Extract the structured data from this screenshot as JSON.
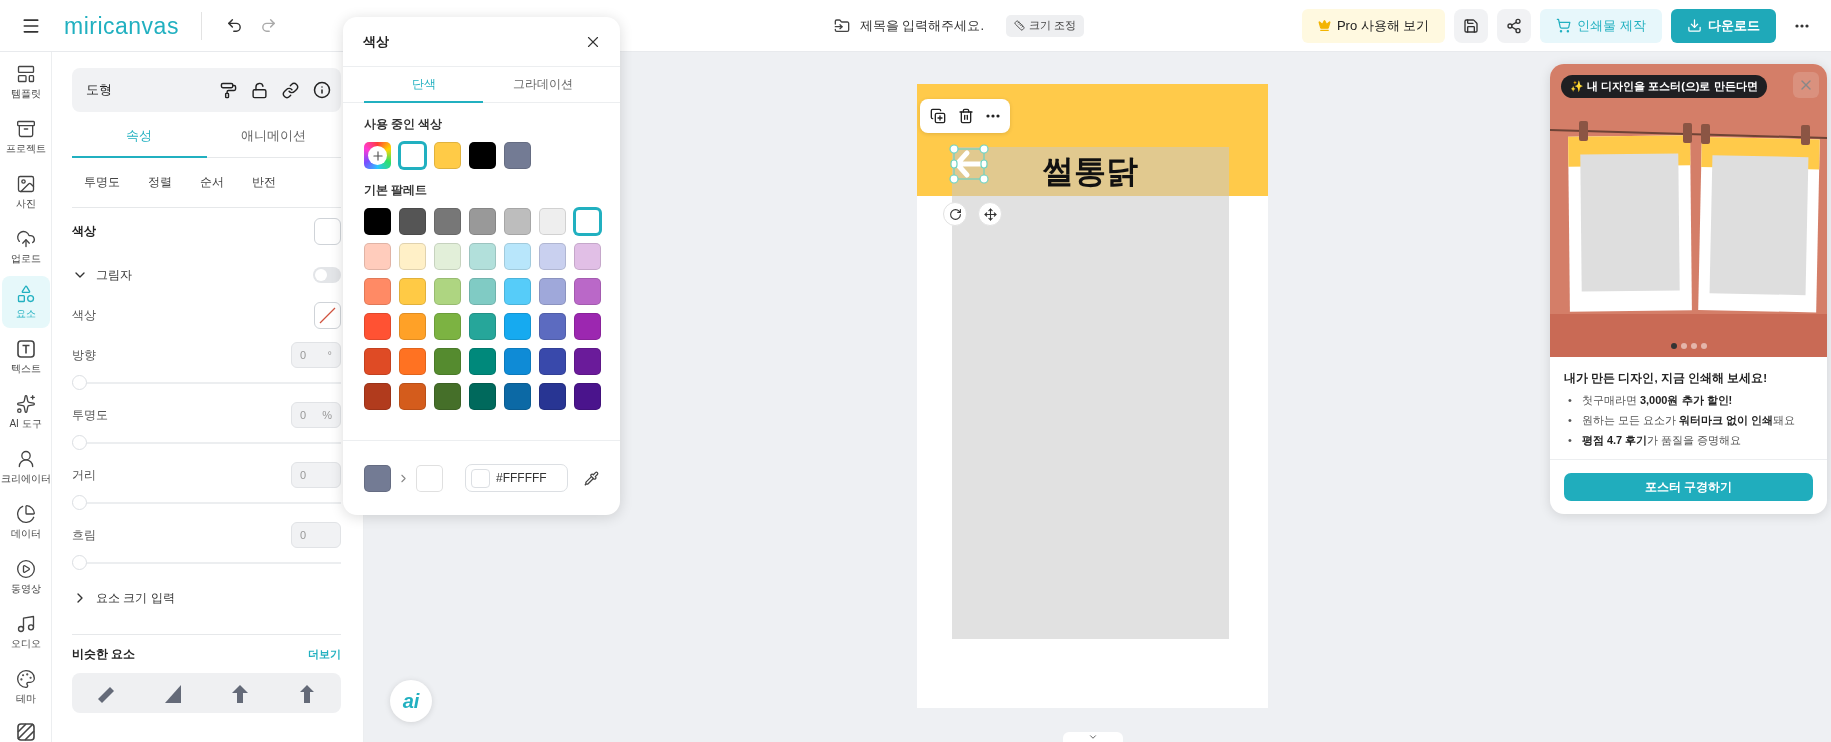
{
  "topbar": {
    "logo": "miricanvas",
    "title_field": {
      "placeholder": "제목을 입력해주세요."
    },
    "resize": "크기 조정",
    "pro_button": "Pro 사용해 보기",
    "print_button": "인쇄물 제작",
    "download_button": "다운로드"
  },
  "rail": [
    {
      "label": "템플릿",
      "selected": false
    },
    {
      "label": "프로젝트",
      "selected": false
    },
    {
      "label": "사진",
      "selected": false
    },
    {
      "label": "업로드",
      "selected": false
    },
    {
      "label": "요소",
      "selected": true
    },
    {
      "label": "텍스트",
      "selected": false
    },
    {
      "label": "AI 도구",
      "selected": false
    },
    {
      "label": "크리에이터",
      "selected": false
    },
    {
      "label": "데이터",
      "selected": false
    },
    {
      "label": "동영상",
      "selected": false
    },
    {
      "label": "오디오",
      "selected": false
    },
    {
      "label": "테마",
      "selected": false
    }
  ],
  "panel": {
    "title": "도형",
    "tabs": [
      {
        "label": "속성",
        "selected": true
      },
      {
        "label": "애니메이션",
        "selected": false
      }
    ],
    "subtabs": [
      "투명도",
      "정렬",
      "순서",
      "반전"
    ],
    "color_label": "색상",
    "color": "#ffffff",
    "shadow": {
      "label": "그림자",
      "expanded": true,
      "on": false,
      "color_label": "색상",
      "sliders": [
        {
          "label": "방향",
          "value": "0",
          "unit": "°",
          "level": 0
        },
        {
          "label": "투명도",
          "value": "0",
          "unit": "%",
          "level": 0
        },
        {
          "label": "거리",
          "value": "0",
          "level": 0
        },
        {
          "label": "흐림",
          "value": "0",
          "level": 0
        }
      ]
    },
    "size_section": {
      "label": "요소 크기 입력",
      "expanded": false
    },
    "similar": {
      "title": "비슷한 요소",
      "more": "더보기"
    }
  },
  "color_popup": {
    "title": "색상",
    "tabs": [
      {
        "label": "단색",
        "selected": true
      },
      {
        "label": "그라데이션",
        "selected": false
      }
    ],
    "used_label": "사용 중인 색상",
    "used": [
      {
        "kind": "add",
        "selected": false
      },
      {
        "kind": "color",
        "color": "#ffffff",
        "selected": true
      },
      {
        "kind": "color",
        "color": "#ffcb47",
        "selected": false
      },
      {
        "kind": "color",
        "color": "#000000",
        "selected": false
      },
      {
        "kind": "color",
        "color": "#737b94",
        "selected": false
      }
    ],
    "palette_label": "기본 팔레트",
    "palette": [
      {
        "color": "#000000",
        "selected": false
      },
      {
        "color": "#555555",
        "selected": false
      },
      {
        "color": "#777777",
        "selected": false
      },
      {
        "color": "#999999",
        "selected": false
      },
      {
        "color": "#bdbdbd",
        "selected": false
      },
      {
        "color": "#eeeeee",
        "selected": false
      },
      {
        "color": "#ffffff",
        "selected": true
      },
      {
        "color": "#ffccbc",
        "selected": false
      },
      {
        "color": "#fff0c7",
        "selected": false
      },
      {
        "color": "#e2efd9",
        "selected": false
      },
      {
        "color": "#b2e0db",
        "selected": false
      },
      {
        "color": "#b8e6fb",
        "selected": false
      },
      {
        "color": "#c9d0ef",
        "selected": false
      },
      {
        "color": "#e1bfe6",
        "selected": false
      },
      {
        "color": "#ff8a65",
        "selected": false
      },
      {
        "color": "#ffca45",
        "selected": false
      },
      {
        "color": "#aed581",
        "selected": false
      },
      {
        "color": "#80cbc4",
        "selected": false
      },
      {
        "color": "#56ccf9",
        "selected": false
      },
      {
        "color": "#9fa8da",
        "selected": false
      },
      {
        "color": "#ba68c8",
        "selected": false
      },
      {
        "color": "#ff5233",
        "selected": false
      },
      {
        "color": "#ffa127",
        "selected": false
      },
      {
        "color": "#7cb342",
        "selected": false
      },
      {
        "color": "#26a69a",
        "selected": false
      },
      {
        "color": "#16aaf0",
        "selected": false
      },
      {
        "color": "#5c6bc0",
        "selected": false
      },
      {
        "color": "#9c27b0",
        "selected": false
      },
      {
        "color": "#df4b25",
        "selected": false
      },
      {
        "color": "#ff7222",
        "selected": false
      },
      {
        "color": "#558b2f",
        "selected": false
      },
      {
        "color": "#00897b",
        "selected": false
      },
      {
        "color": "#0f8bd6",
        "selected": false
      },
      {
        "color": "#3949ab",
        "selected": false
      },
      {
        "color": "#6a1b9a",
        "selected": false
      },
      {
        "color": "#b13b1d",
        "selected": false
      },
      {
        "color": "#d45c1c",
        "selected": false
      },
      {
        "color": "#456f29",
        "selected": false
      },
      {
        "color": "#00695c",
        "selected": false
      },
      {
        "color": "#0c69a5",
        "selected": false
      },
      {
        "color": "#283593",
        "selected": false
      },
      {
        "color": "#4a148c",
        "selected": false
      }
    ],
    "previous": {
      "color": "#737b94"
    },
    "current": {
      "color": "#ffffff"
    },
    "hex": "#FFFFFF"
  },
  "canvas": {
    "heading": "썰통닭"
  },
  "ai_button": "ai",
  "promo": {
    "badge": "✨ 내 디자인을 포스터(으)로 만든다면",
    "slides": [
      {
        "selected": true
      },
      {
        "selected": false
      },
      {
        "selected": false
      },
      {
        "selected": false
      }
    ],
    "title": "내가 만든 디자인, 지금 인쇄해 보세요!",
    "bullets": [
      {
        "marker": "•",
        "text": "첫구매라면 **3,000원 추가 할인!**"
      },
      {
        "marker": "•",
        "text": "원하는 모든 요소가 **워터마크 없이 인쇄**돼요"
      },
      {
        "marker": "•",
        "text": "**평점 4.7 후기**가 품질을 증명해요"
      }
    ],
    "button": "포스터 구경하기"
  }
}
